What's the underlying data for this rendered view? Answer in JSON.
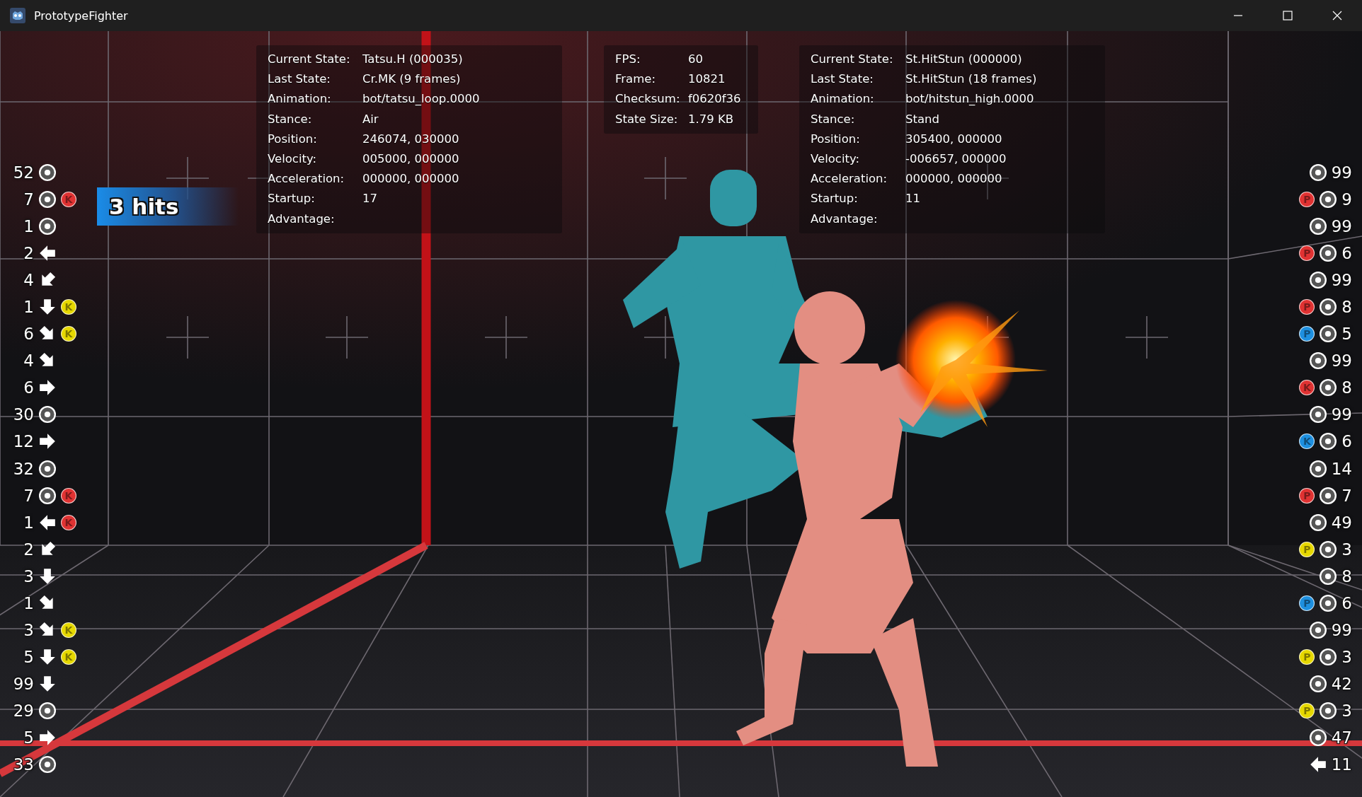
{
  "window": {
    "title": "PrototypeFighter"
  },
  "player1_debug": [
    {
      "label": "Current State:",
      "value": "Tatsu.H (000035)"
    },
    {
      "label": "Last State:",
      "value": "Cr.MK (9 frames)"
    },
    {
      "label": "Animation:",
      "value": "bot/tatsu_loop.0000"
    },
    {
      "label": "Stance:",
      "value": "Air"
    },
    {
      "label": "Position:",
      "value": "246074, 030000"
    },
    {
      "label": "Velocity:",
      "value": "005000, 000000"
    },
    {
      "label": "Acceleration:",
      "value": "000000, 000000"
    },
    {
      "label": "Startup:",
      "value": "17"
    },
    {
      "label": "Advantage:"
    }
  ],
  "system_debug": [
    {
      "label": "FPS:",
      "value": "60"
    },
    {
      "label": "Frame:",
      "value": "10821"
    },
    {
      "label": "Checksum:",
      "value": "f0620f36"
    },
    {
      "label": "State Size:",
      "value": "1.79 KB"
    }
  ],
  "player2_debug": [
    {
      "label": "Current State:",
      "value": "St.HitStun (000000)"
    },
    {
      "label": "Last State:",
      "value": "St.HitStun (18 frames)"
    },
    {
      "label": "Animation:",
      "value": "bot/hitstun_high.0000"
    },
    {
      "label": "Stance:",
      "value": "Stand"
    },
    {
      "label": "Position:",
      "value": "305400, 000000"
    },
    {
      "label": "Velocity:",
      "value": "-006657, 000000"
    },
    {
      "label": "Acceleration:",
      "value": "000000, 000000"
    },
    {
      "label": "Startup:",
      "value": "11"
    },
    {
      "label": "Advantage:"
    }
  ],
  "combo_counter": "3 hits",
  "player1_inputs": [
    {
      "frames": "52",
      "kind": "neutral"
    },
    {
      "frames": "7",
      "kind": "neutral",
      "buttons": [
        {
          "label": "K",
          "color": "#e03232"
        }
      ]
    },
    {
      "frames": "1",
      "kind": "neutral"
    },
    {
      "frames": "2",
      "kind": "left"
    },
    {
      "frames": "4",
      "kind": "down-left"
    },
    {
      "frames": "1",
      "kind": "down",
      "buttons": [
        {
          "label": "K",
          "color": "#e6d800"
        }
      ]
    },
    {
      "frames": "6",
      "kind": "down-right",
      "buttons": [
        {
          "label": "K",
          "color": "#e6d800"
        }
      ]
    },
    {
      "frames": "4",
      "kind": "down-right"
    },
    {
      "frames": "6",
      "kind": "right"
    },
    {
      "frames": "30",
      "kind": "neutral"
    },
    {
      "frames": "12",
      "kind": "right"
    },
    {
      "frames": "32",
      "kind": "neutral"
    },
    {
      "frames": "7",
      "kind": "neutral",
      "buttons": [
        {
          "label": "K",
          "color": "#e03232"
        }
      ]
    },
    {
      "frames": "1",
      "kind": "left",
      "buttons": [
        {
          "label": "K",
          "color": "#e03232"
        }
      ]
    },
    {
      "frames": "2",
      "kind": "down-left"
    },
    {
      "frames": "3",
      "kind": "down"
    },
    {
      "frames": "1",
      "kind": "down-right"
    },
    {
      "frames": "3",
      "kind": "down-right",
      "buttons": [
        {
          "label": "K",
          "color": "#e6d800"
        }
      ]
    },
    {
      "frames": "5",
      "kind": "down",
      "buttons": [
        {
          "label": "K",
          "color": "#e6d800"
        }
      ]
    },
    {
      "frames": "99",
      "kind": "down"
    },
    {
      "frames": "29",
      "kind": "neutral"
    },
    {
      "frames": "5",
      "kind": "right"
    },
    {
      "frames": "33",
      "kind": "neutral"
    }
  ],
  "player2_inputs": [
    {
      "frames": "99",
      "kind": "neutral"
    },
    {
      "frames": "9",
      "kind": "neutral",
      "buttons": [
        {
          "label": "P",
          "color": "#e03232"
        }
      ]
    },
    {
      "frames": "99",
      "kind": "neutral"
    },
    {
      "frames": "6",
      "kind": "neutral",
      "buttons": [
        {
          "label": "P",
          "color": "#e03232"
        }
      ]
    },
    {
      "frames": "99",
      "kind": "neutral"
    },
    {
      "frames": "8",
      "kind": "neutral",
      "buttons": [
        {
          "label": "P",
          "color": "#e03232"
        }
      ]
    },
    {
      "frames": "5",
      "kind": "neutral",
      "buttons": [
        {
          "label": "P",
          "color": "#1e90e0"
        }
      ]
    },
    {
      "frames": "99",
      "kind": "neutral"
    },
    {
      "frames": "8",
      "kind": "neutral",
      "buttons": [
        {
          "label": "K",
          "color": "#e03232"
        }
      ]
    },
    {
      "frames": "99",
      "kind": "neutral"
    },
    {
      "frames": "6",
      "kind": "neutral",
      "buttons": [
        {
          "label": "K",
          "color": "#1e90e0"
        }
      ]
    },
    {
      "frames": "14",
      "kind": "neutral"
    },
    {
      "frames": "7",
      "kind": "neutral",
      "buttons": [
        {
          "label": "P",
          "color": "#e03232"
        }
      ]
    },
    {
      "frames": "49",
      "kind": "neutral"
    },
    {
      "frames": "3",
      "kind": "neutral",
      "buttons": [
        {
          "label": "P",
          "color": "#e6d800"
        }
      ]
    },
    {
      "frames": "8",
      "kind": "neutral"
    },
    {
      "frames": "6",
      "kind": "neutral",
      "buttons": [
        {
          "label": "P",
          "color": "#1e90e0"
        }
      ]
    },
    {
      "frames": "99",
      "kind": "neutral"
    },
    {
      "frames": "3",
      "kind": "neutral",
      "buttons": [
        {
          "label": "P",
          "color": "#e6d800"
        }
      ]
    },
    {
      "frames": "42",
      "kind": "neutral"
    },
    {
      "frames": "3",
      "kind": "neutral",
      "buttons": [
        {
          "label": "P",
          "color": "#e6d800"
        }
      ]
    },
    {
      "frames": "47",
      "kind": "neutral"
    },
    {
      "frames": "11",
      "kind": "left"
    }
  ]
}
